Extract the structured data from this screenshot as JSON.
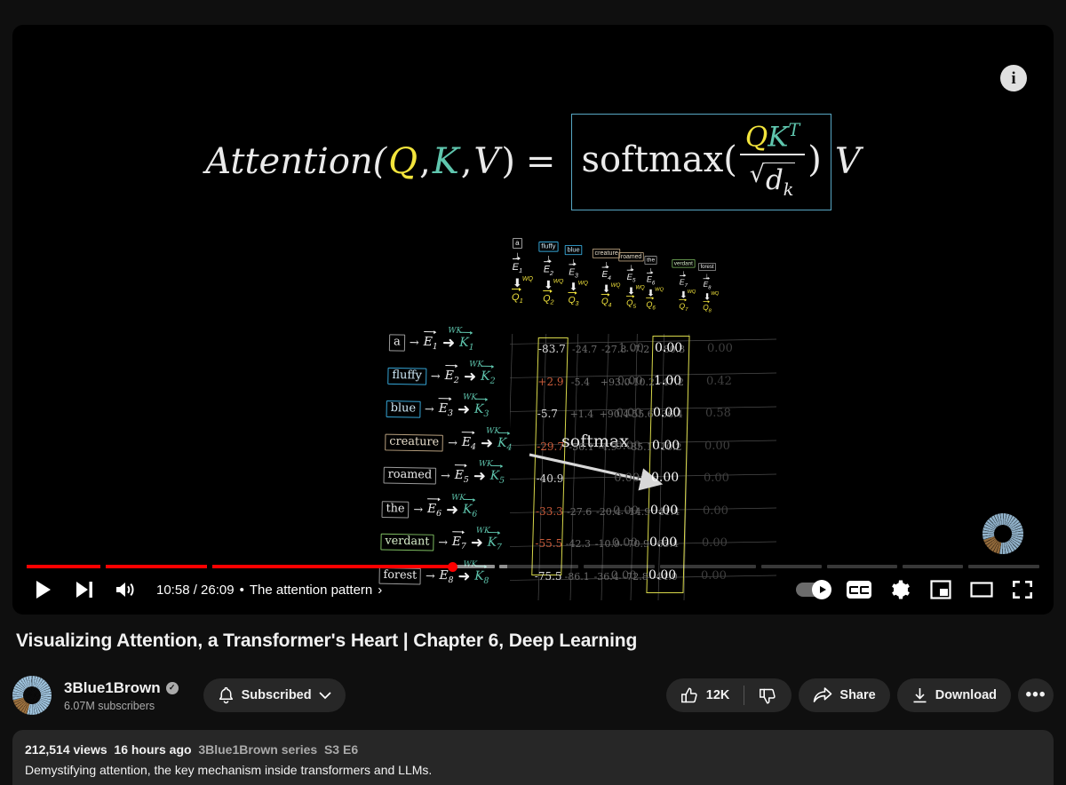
{
  "player": {
    "info_icon": "info-icon",
    "watermark": "channel-watermark-3blue1brown",
    "time_display": "10:58 / 26:09",
    "separator": "•",
    "chapter_title": "The attention pattern",
    "chapter_chevron": "›",
    "controls": {
      "play": "play-icon",
      "next": "next-video-icon",
      "volume": "volume-icon",
      "autoplay": "autoplay-toggle",
      "captions": "CC",
      "settings": "gear-icon",
      "miniplayer": "miniplayer-icon",
      "theater": "theater-mode-icon",
      "fullscreen": "fullscreen-icon"
    },
    "progress": {
      "played_fraction": 0.42,
      "buffered_fraction": 0.475,
      "chapters": [
        {
          "start": 0.0,
          "end": 0.073
        },
        {
          "start": 0.078,
          "end": 0.178
        },
        {
          "start": 0.183,
          "end": 0.462
        },
        {
          "start": 0.467,
          "end": 0.545
        },
        {
          "start": 0.55,
          "end": 0.62
        },
        {
          "start": 0.625,
          "end": 0.72
        },
        {
          "start": 0.725,
          "end": 0.785
        },
        {
          "start": 0.79,
          "end": 0.86
        },
        {
          "start": 0.865,
          "end": 0.925
        },
        {
          "start": 0.93,
          "end": 1.0
        }
      ]
    }
  },
  "video_frame": {
    "formula": {
      "lhs": "Attention(",
      "q": "Q",
      "comma1": ", ",
      "k": "K",
      "comma2": ", ",
      "v": "V",
      "close": ")",
      "equals": "=",
      "softmax": "softmax(",
      "numerator_q": "Q",
      "numerator_k": "K",
      "numerator_sup": "T",
      "denominator_radical": "√",
      "denominator_d": "d",
      "denominator_sub": "k",
      "close_paren": ")",
      "trailing_v": "V",
      "box_color": "#57a7c4",
      "q_color": "#f2e43c",
      "k_color": "#5fc6ae"
    },
    "softmax_label": "softmax",
    "rows": [
      {
        "word": "a",
        "style": "plain",
        "e": "E",
        "k": "K",
        "index": "1"
      },
      {
        "word": "fluffy",
        "style": "blue",
        "e": "E",
        "k": "K",
        "index": "2"
      },
      {
        "word": "blue",
        "style": "blue",
        "e": "E",
        "k": "K",
        "index": "3"
      },
      {
        "word": "creature",
        "style": "tan",
        "e": "E",
        "k": "K",
        "index": "4"
      },
      {
        "word": "roamed",
        "style": "plain",
        "e": "E",
        "k": "K",
        "index": "5"
      },
      {
        "word": "the",
        "style": "plain",
        "e": "E",
        "k": "K",
        "index": "6"
      },
      {
        "word": "verdant",
        "style": "green",
        "e": "E",
        "k": "K",
        "index": "7"
      },
      {
        "word": "forest",
        "style": "plain",
        "e": "E",
        "k": "K",
        "index": "8"
      }
    ],
    "columns": [
      {
        "word": "a",
        "style": "plain",
        "e": "E",
        "q": "Q",
        "index": "1"
      },
      {
        "word": "fluffy",
        "style": "blue",
        "e": "E",
        "q": "Q",
        "index": "2"
      },
      {
        "word": "blue",
        "style": "blue",
        "e": "E",
        "q": "Q",
        "index": "3"
      },
      {
        "word": "creature",
        "style": "tan",
        "e": "E",
        "q": "Q",
        "index": "4"
      },
      {
        "word": "roamed",
        "style": "tan",
        "e": "E",
        "q": "Q",
        "index": "5"
      },
      {
        "word": "the",
        "style": "plain",
        "e": "E",
        "q": "Q",
        "index": "6"
      },
      {
        "word": "verdant",
        "style": "green",
        "e": "E",
        "q": "Q",
        "index": "7"
      },
      {
        "word": "forest",
        "style": "plain",
        "e": "E",
        "q": "Q",
        "index": "8"
      }
    ],
    "wq_label": "WQ",
    "wk_label": "WK",
    "dot_column_values": [
      "-83.7",
      "+2.9",
      "-5.7",
      "-29.7",
      "-40.9",
      "-33.3",
      "-55.5",
      "-75.5"
    ],
    "dot_column_colors": [
      "#d9d9d9",
      "#c95b3a",
      "#d9d9d9",
      "#c95b3a",
      "#d9d9d9",
      "#c95b3a",
      "#c95b3a",
      "#d9d9d9"
    ],
    "softmax_column_values": [
      "0.00",
      "1.00",
      "0.00",
      "0.00",
      "0.00",
      "0.00",
      "0.00",
      "0.00"
    ],
    "second_column_values": [
      "0.00",
      "0.42",
      "0.58",
      "0.00",
      "0.00",
      "0.00",
      "0.00",
      "0.00"
    ],
    "prev_column_values": [
      "1.00",
      "0.00",
      "0.00",
      "0.00",
      "0.00",
      "0.00",
      "0.00",
      "0.00"
    ],
    "grid_numbers_row1": [
      "-24.7",
      "-27.8",
      "-7.2",
      "-80.3"
    ],
    "grid_numbers_row2": [
      "-5.4",
      "+93.0",
      "-10.2",
      "-47.2"
    ],
    "grid_numbers_row3": [
      "+1.4",
      "+90.4",
      "-55.6",
      "-36.4"
    ],
    "grid_numbers_row4": [
      "-56.1",
      "-4.9",
      "-85.1",
      "-10.2"
    ],
    "grid_numbers_row6": [
      "-27.6",
      "-20.4",
      "-14.9",
      "-41.4"
    ],
    "grid_numbers_row7": [
      "-42.3",
      "-10.9",
      "-70.9",
      "-65.4"
    ],
    "grid_numbers_row8": [
      "-86.1",
      "-36.4",
      "-72.8",
      "-44.0"
    ],
    "highlight_color": "#d8d84a"
  },
  "video": {
    "title": "Visualizing Attention, a Transformer's Heart | Chapter 6, Deep Learning"
  },
  "channel": {
    "name": "3Blue1Brown",
    "verified_glyph": "✓",
    "subscribers": "6.07M subscribers",
    "subscribe_label": "Subscribed",
    "bell_icon": "bell-icon",
    "chevron_icon": "chevron-down-icon",
    "avatar": "channel-avatar"
  },
  "actions": {
    "like_count": "12K",
    "like_icon": "thumbs-up-icon",
    "dislike_icon": "thumbs-down-icon",
    "share_label": "Share",
    "share_icon": "share-icon",
    "download_label": "Download",
    "download_icon": "download-icon",
    "more_label": "•••"
  },
  "description": {
    "views": "212,514 views",
    "published": "16 hours ago",
    "series": "3Blue1Brown series",
    "episode": "S3 E6",
    "snippet": "Demystifying attention, the key mechanism inside transformers and LLMs."
  }
}
